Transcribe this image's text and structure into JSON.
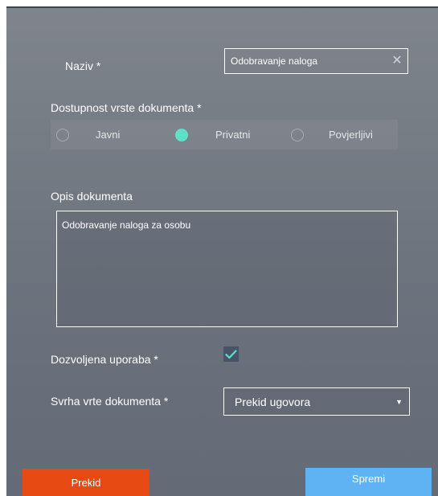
{
  "form": {
    "name": {
      "label": "Naziv *",
      "value": "Odobravanje naloga",
      "clear_icon": "close-icon"
    },
    "access": {
      "label": "Dostupnost vrste dokumenta *",
      "options": [
        {
          "label": "Javni",
          "selected": false
        },
        {
          "label": "Privatni",
          "selected": true
        },
        {
          "label": "Povjerljivi",
          "selected": false
        }
      ],
      "selected_color": "#5fe0c8"
    },
    "description": {
      "label": "Opis dokumenta",
      "value": "Odobravanje naloga za osobu"
    },
    "allowed_use": {
      "label": "Dozvoljena uporaba *",
      "checked": true,
      "check_color": "#5fe0c8"
    },
    "purpose": {
      "label": "Svrha vrte dokumenta *",
      "selected": "Prekid ugovora"
    }
  },
  "buttons": {
    "cancel": {
      "label": "Prekid",
      "color": "#e64a12"
    },
    "save": {
      "label": "Spremi",
      "color": "#5fb3f2"
    }
  }
}
